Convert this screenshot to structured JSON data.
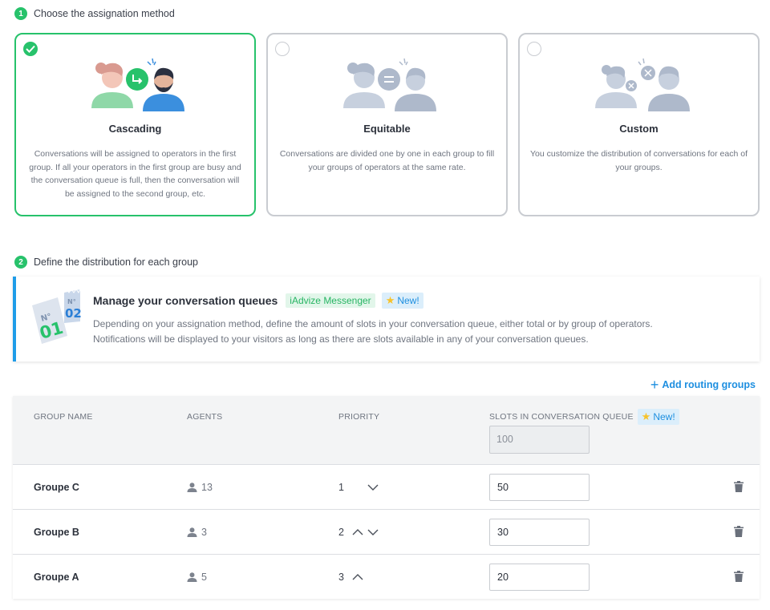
{
  "step1": {
    "number": "1",
    "label": "Choose the assignation method"
  },
  "methods": [
    {
      "title": "Cascading",
      "selected": true,
      "description": "Conversations will be assigned to operators in the first group. If all your operators in the first group are busy and the conversation queue is full, then the conversation will be assigned to the second group, etc."
    },
    {
      "title": "Equitable",
      "selected": false,
      "description": "Conversations are divided one by one in each group to fill your groups of operators at the same rate."
    },
    {
      "title": "Custom",
      "selected": false,
      "description": "You customize the distribution of conversations for each of your groups."
    }
  ],
  "step2": {
    "number": "2",
    "label": "Define the distribution for each group"
  },
  "banner": {
    "title": "Manage your conversation queues",
    "tag_messenger": "iAdvize Messenger",
    "tag_new": "New!",
    "line1": "Depending on your assignation method, define the amount of slots in your conversation queue, either total or by group of operators.",
    "line2": "Notifications will be displayed to your visitors as long as there are slots available in any of your conversation queues.",
    "badge_no_small": "N°",
    "badge_02": "02",
    "badge_no_big": "N°",
    "badge_01": "01"
  },
  "add_routing": {
    "label": "Add routing groups"
  },
  "table": {
    "headers": {
      "group_name": "GROUP NAME",
      "agents": "AGENTS",
      "priority": "PRIORITY",
      "slots": "SLOTS IN CONVERSATION QUEUE",
      "slots_new": "New!"
    },
    "total_slots": "100",
    "rows": [
      {
        "name": "Groupe C",
        "agents": "13",
        "priority": "1",
        "slots": "50"
      },
      {
        "name": "Groupe B",
        "agents": "3",
        "priority": "2",
        "slots": "30"
      },
      {
        "name": "Groupe A",
        "agents": "5",
        "priority": "3",
        "slots": "20"
      }
    ]
  },
  "colors": {
    "accent_green": "#27c26b",
    "accent_blue": "#1e9ce8",
    "border": "#c9ccd1"
  }
}
